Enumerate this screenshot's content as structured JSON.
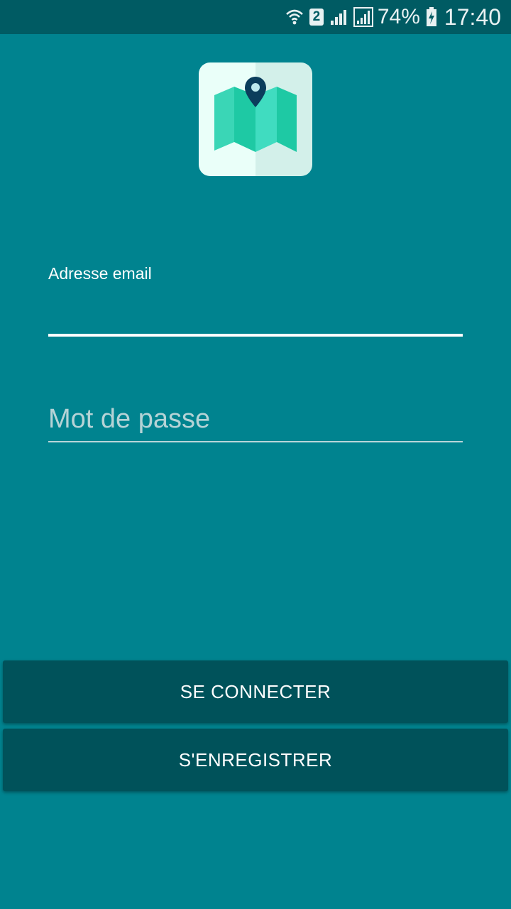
{
  "status_bar": {
    "sim_slot": "2",
    "battery": "74%",
    "time": "17:40",
    "icons": [
      "wifi-icon",
      "sim-badge",
      "signal-icon",
      "signal-icon",
      "battery-charging-icon"
    ]
  },
  "logo": {
    "icon": "map-pin-icon"
  },
  "form": {
    "email": {
      "label": "Adresse email",
      "value": ""
    },
    "password": {
      "placeholder": "Mot de passe",
      "value": ""
    }
  },
  "buttons": {
    "login": "SE CONNECTER",
    "register": "S'ENREGISTRER"
  },
  "colors": {
    "background": "#00838f",
    "status_bar": "#005b63",
    "button": "#00525a",
    "text": "#ffffff"
  }
}
